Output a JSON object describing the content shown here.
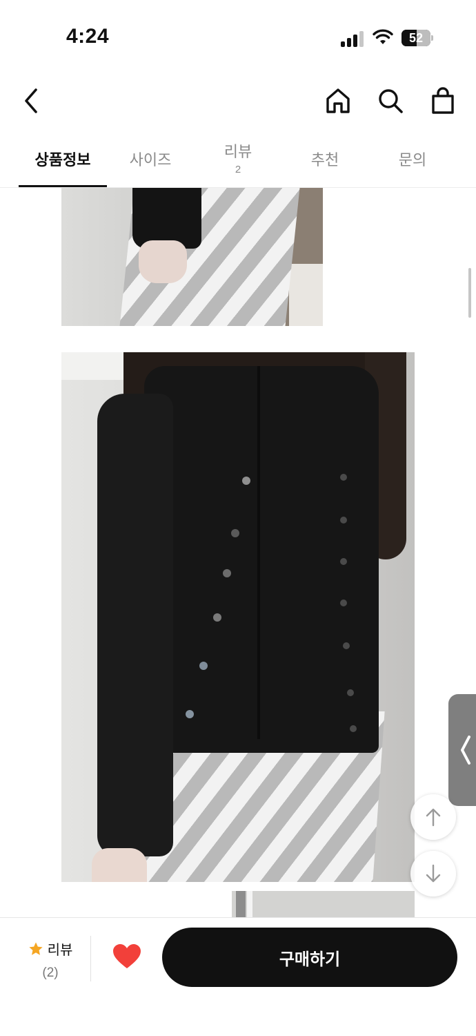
{
  "status_bar": {
    "time": "4:24",
    "battery_level": "52",
    "battery_fraction": 0.52
  },
  "nav": {
    "back_icon": "chevron-left-icon",
    "home_icon": "home-icon",
    "search_icon": "search-icon",
    "cart_icon": "shopping-bag-icon"
  },
  "tabs": [
    {
      "label": "상품정보",
      "count": ""
    },
    {
      "label": "사이즈",
      "count": ""
    },
    {
      "label": "리뷰",
      "count": "2"
    },
    {
      "label": "추천",
      "count": ""
    },
    {
      "label": "문의",
      "count": ""
    }
  ],
  "active_tab": 0,
  "floating": {
    "side_tab_icon": "chevron-left-icon",
    "scroll_up_icon": "arrow-up-icon",
    "scroll_down_icon": "arrow-down-icon"
  },
  "bottom_bar": {
    "review_label": "리뷰",
    "review_count": "(2)",
    "star_icon": "star-icon",
    "wishlist_icon": "heart-icon",
    "buy_label": "구매하기"
  },
  "colors": {
    "accent_star": "#F5A623",
    "heart": "#F2403A",
    "buy_button": "#111111",
    "tab_active": "#111111",
    "tab_inactive": "#8A8A8A"
  }
}
